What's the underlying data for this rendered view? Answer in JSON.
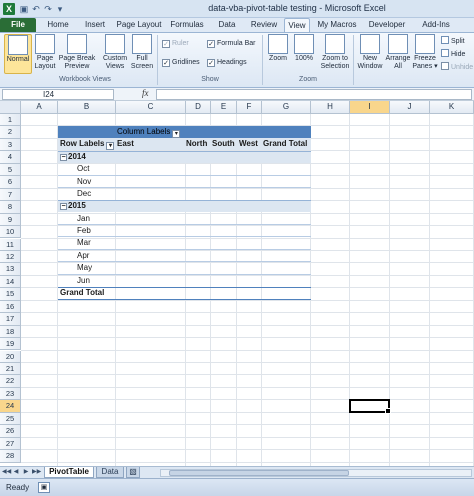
{
  "window": {
    "title": "data-vba-pivot-table testing  -  Microsoft Excel"
  },
  "ribbon_tabs": [
    {
      "label": "File",
      "state": "file"
    },
    {
      "label": "Home",
      "state": ""
    },
    {
      "label": "Insert",
      "state": ""
    },
    {
      "label": "Page Layout",
      "state": ""
    },
    {
      "label": "Formulas",
      "state": ""
    },
    {
      "label": "Data",
      "state": ""
    },
    {
      "label": "Review",
      "state": ""
    },
    {
      "label": "View",
      "state": "active"
    },
    {
      "label": "My Macros",
      "state": ""
    },
    {
      "label": "Developer",
      "state": ""
    },
    {
      "label": "Add-Ins",
      "state": ""
    }
  ],
  "ribbon": {
    "workbook_views": {
      "normal": "Normal",
      "page_layout": "Page Layout",
      "page_break_preview": "Page Break Preview",
      "custom_views": "Custom Views",
      "full_screen": "Full Screen",
      "group_label": "Workbook Views"
    },
    "show": {
      "ruler": "Ruler",
      "gridlines": "Gridlines",
      "formula_bar": "Formula Bar",
      "headings": "Headings",
      "group_label": "Show"
    },
    "zoom": {
      "zoom": "Zoom",
      "zoom_100": "100%",
      "zoom_to_selection": "Zoom to Selection",
      "group_label": "Zoom"
    },
    "window": {
      "new_window": "New Window",
      "arrange_all": "Arrange All",
      "freeze_panes": "Freeze Panes ▾",
      "split": "Split",
      "hide": "Hide",
      "unhide": "Unhide"
    }
  },
  "formula_bar": {
    "name_box": "I24",
    "fx": "fx",
    "formula": ""
  },
  "columns": [
    "A",
    "B",
    "C",
    "D",
    "E",
    "F",
    "G",
    "H",
    "I",
    "J",
    "K"
  ],
  "selected_column": "I",
  "rows": [
    "1",
    "2",
    "3",
    "4",
    "5",
    "6",
    "7",
    "8",
    "9",
    "10",
    "11",
    "12",
    "13",
    "14",
    "15",
    "16",
    "17",
    "18",
    "19",
    "20",
    "21",
    "22",
    "23",
    "24",
    "25",
    "26",
    "27",
    "28"
  ],
  "selected_row": "24",
  "pivot": {
    "column_labels": "Column Labels",
    "row_labels": "Row Labels",
    "headers": [
      "East",
      "North",
      "South",
      "West",
      "Grand Total"
    ],
    "year_2014": "2014",
    "months_2014": [
      "Oct",
      "Nov",
      "Dec"
    ],
    "year_2015": "2015",
    "months_2015": [
      "Jan",
      "Feb",
      "Mar",
      "Apr",
      "May",
      "Jun"
    ],
    "grand_total": "Grand Total"
  },
  "sheets": {
    "active": "PivotTable",
    "other": "Data"
  },
  "status": {
    "ready": "Ready"
  },
  "colors": {
    "pivot_header": "#4f81bd",
    "pivot_band": "#dce6f1",
    "file_tab": "#2a6d36"
  }
}
